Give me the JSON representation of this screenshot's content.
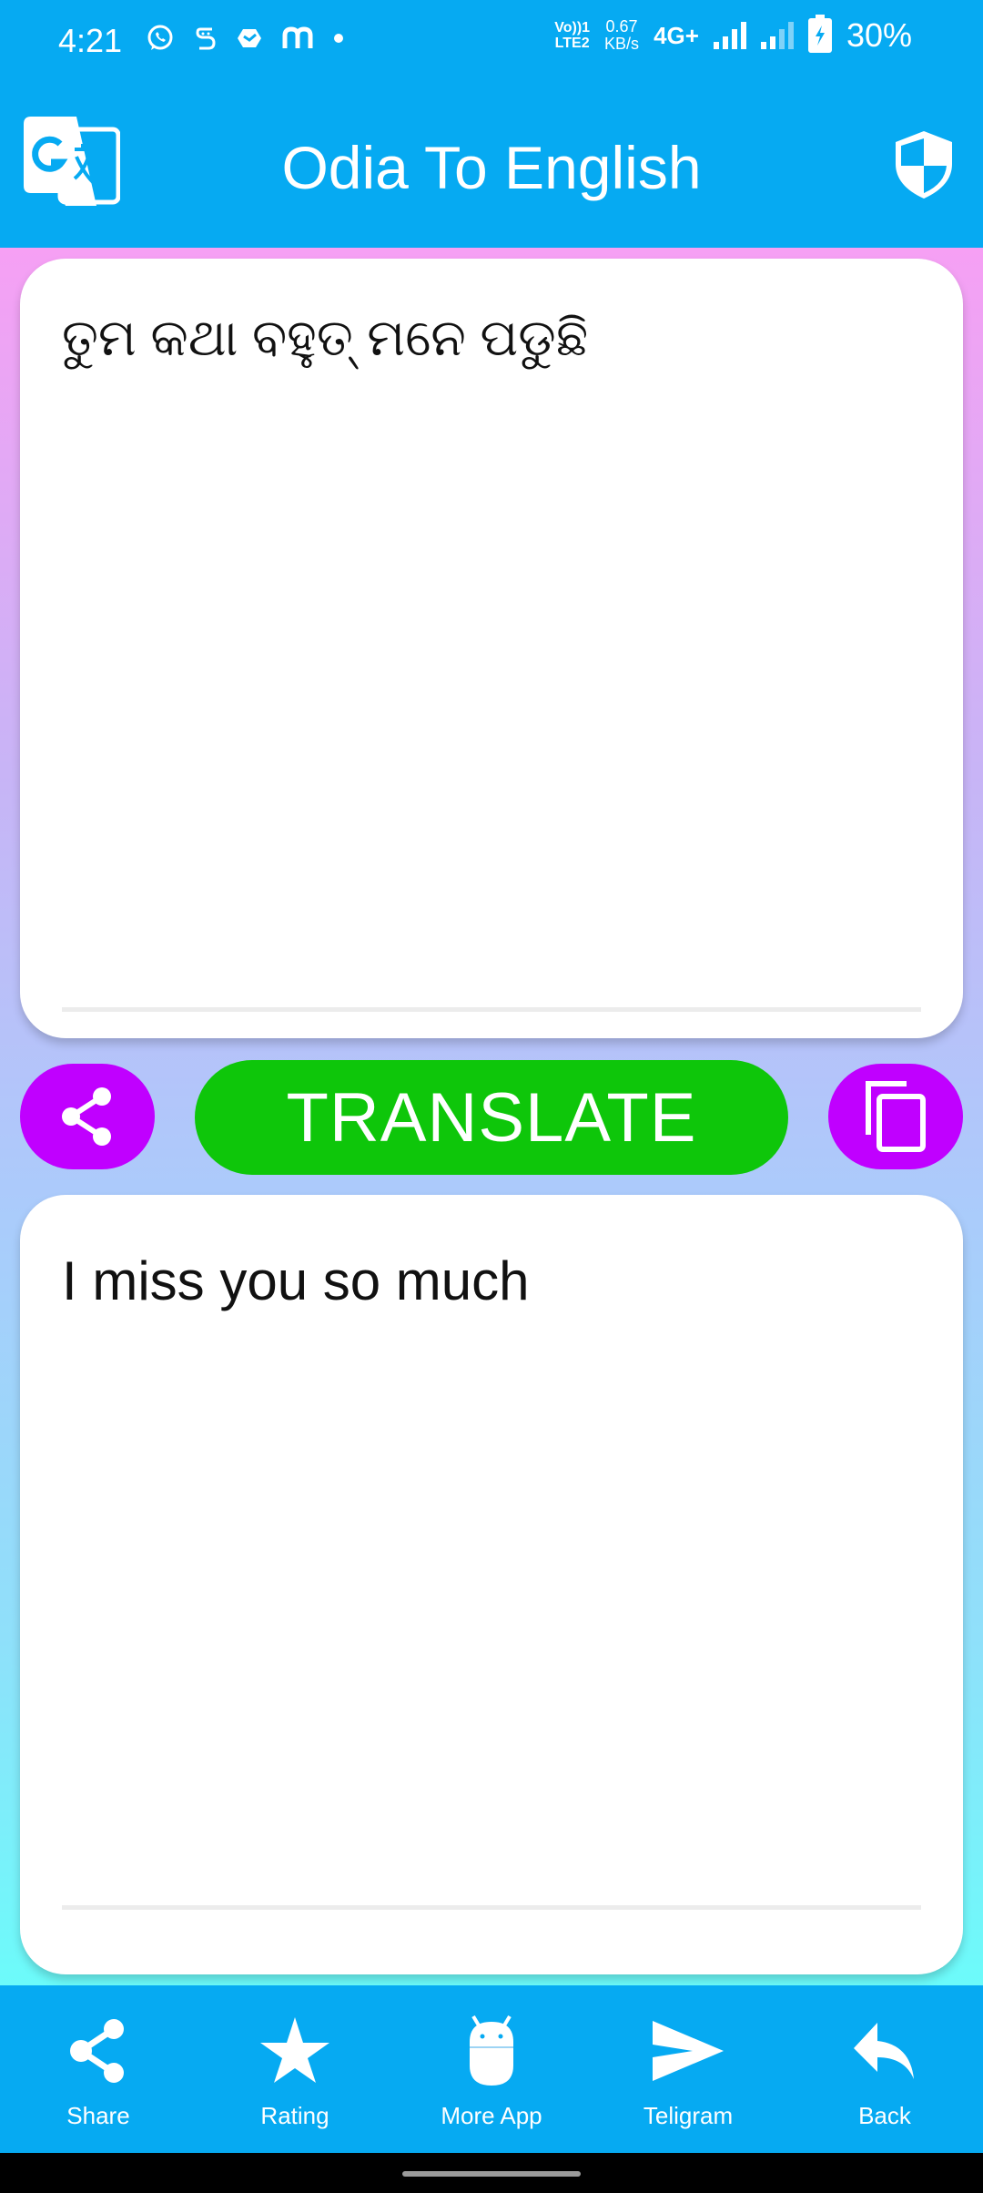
{
  "status_bar": {
    "time": "4:21",
    "notification_icons": [
      "whatsapp-icon",
      "s-app-icon",
      "box-app-icon",
      "m-app-icon",
      "dot-icon"
    ],
    "volte": "Vo))1",
    "lte": "LTE2",
    "speed_value": "0.67",
    "speed_unit": "KB/s",
    "network": "4G+",
    "battery": "30%"
  },
  "app_bar": {
    "title": "Odia To English",
    "logo_icon": "google-translate-icon",
    "privacy_icon": "shield-icon"
  },
  "input_card": {
    "text": "ତୁମ କଥା ବହୁତ୍ ମନେ ପଡୁଛି"
  },
  "actions": {
    "share_icon": "share-icon",
    "translate_label": "TRANSLATE",
    "copy_icon": "copy-icon"
  },
  "output_card": {
    "text": "I miss you so much"
  },
  "bottom_nav": {
    "items": [
      {
        "label": "Share",
        "icon": "share-icon"
      },
      {
        "label": "Rating",
        "icon": "star-icon"
      },
      {
        "label": "More App",
        "icon": "android-icon"
      },
      {
        "label": "Teligram",
        "icon": "send-icon"
      },
      {
        "label": "Back",
        "icon": "reply-icon"
      }
    ]
  },
  "colors": {
    "primary": "#06aaf2",
    "translate_button": "#0ec60a",
    "action_buttons": "#c000ff",
    "gradient_top": "#f6a0f4",
    "gradient_bottom": "#6cfbfa"
  }
}
